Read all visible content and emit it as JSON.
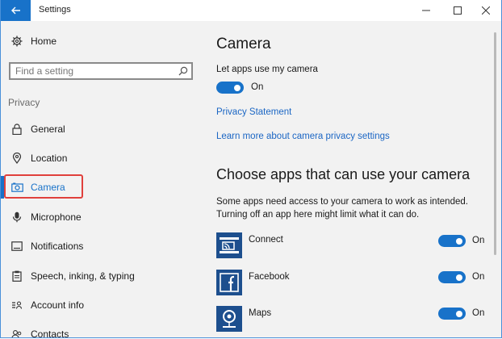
{
  "window": {
    "title": "Settings"
  },
  "colors": {
    "accent": "#1872c9",
    "highlight": "#e0403c",
    "link": "#1b66c4",
    "app_tile": "#1d4f8e"
  },
  "sidebar": {
    "home_label": "Home",
    "search_placeholder": "Find a setting",
    "section": "Privacy",
    "items": [
      {
        "label": "General",
        "icon": "lock-icon"
      },
      {
        "label": "Location",
        "icon": "location-pin-icon"
      },
      {
        "label": "Camera",
        "icon": "camera-icon",
        "selected": true
      },
      {
        "label": "Microphone",
        "icon": "microphone-icon"
      },
      {
        "label": "Notifications",
        "icon": "notifications-icon"
      },
      {
        "label": "Speech, inking, & typing",
        "icon": "clipboard-icon"
      },
      {
        "label": "Account info",
        "icon": "account-info-icon"
      },
      {
        "label": "Contacts",
        "icon": "contacts-icon"
      }
    ]
  },
  "main": {
    "title": "Camera",
    "setting_label": "Let apps use my camera",
    "setting_state": "On",
    "privacy_link": "Privacy Statement",
    "learn_link": "Learn more about camera privacy settings",
    "apps_heading": "Choose apps that can use your camera",
    "apps_desc_line1": "Some apps need access to your camera to work as intended.",
    "apps_desc_line2": "Turning off an app here might limit what it can do.",
    "apps": [
      {
        "name": "Connect",
        "state": "On",
        "icon": "connect-icon"
      },
      {
        "name": "Facebook",
        "state": "On",
        "icon": "facebook-icon"
      },
      {
        "name": "Maps",
        "state": "On",
        "icon": "maps-icon"
      }
    ]
  }
}
